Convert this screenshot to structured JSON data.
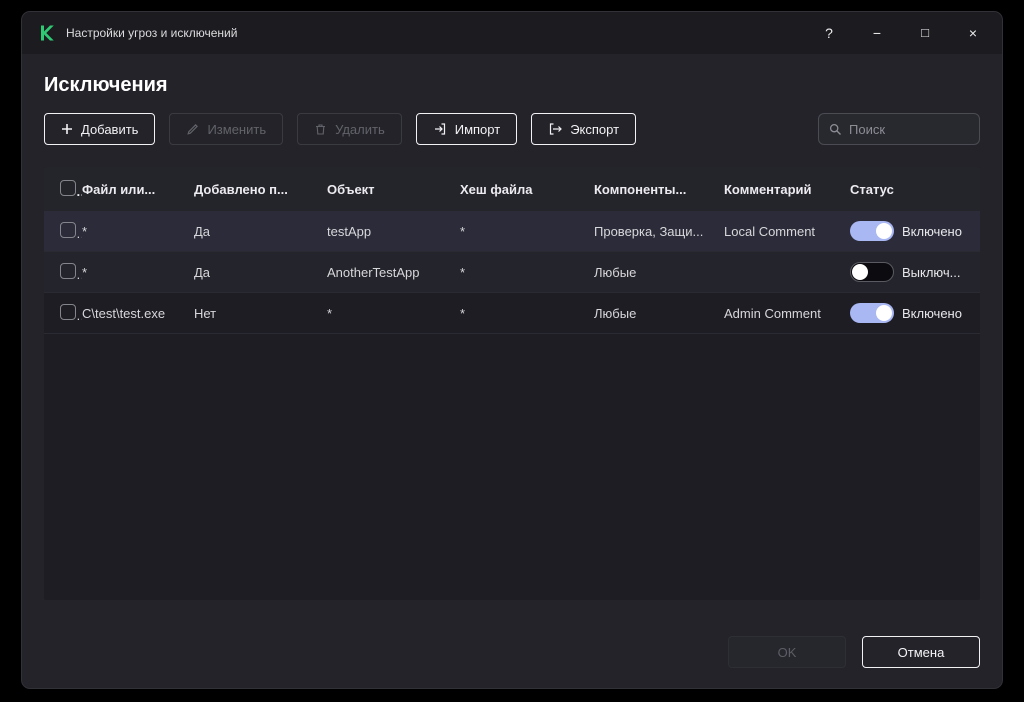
{
  "window": {
    "title": "Настройки угроз и исключений",
    "controls": {
      "help": "?",
      "minimize": "−",
      "maximize": "□",
      "close": "×"
    }
  },
  "page": {
    "title": "Исключения"
  },
  "toolbar": {
    "add": "Добавить",
    "edit": "Изменить",
    "delete": "Удалить",
    "import": "Импорт",
    "export": "Экспорт",
    "search_placeholder": "Поиск"
  },
  "table": {
    "headers": [
      "Файл или...",
      "Добавлено п...",
      "Объект",
      "Хеш файла",
      "Компоненты...",
      "Комментарий",
      "Статус"
    ],
    "rows": [
      {
        "file": "*",
        "added": "Да",
        "object": "testApp",
        "hash": "*",
        "components": "Проверка, Защи...",
        "comment": "Local Comment",
        "status": "Включено",
        "enabled": true
      },
      {
        "file": "*",
        "added": "Да",
        "object": "AnotherTestApp",
        "hash": "*",
        "components": "Любые",
        "comment": "",
        "status": "Выключ...",
        "enabled": false
      },
      {
        "file": "C\\test\\test.exe",
        "added": "Нет",
        "object": "*",
        "hash": "*",
        "components": "Любые",
        "comment": "Admin Comment",
        "status": "Включено",
        "enabled": true
      }
    ]
  },
  "footer": {
    "ok": "OK",
    "cancel": "Отмена"
  },
  "colors": {
    "toggle_on": "#a9b7f3",
    "logo_green": "#2fc974",
    "accent_border": "#f2f2f4"
  }
}
